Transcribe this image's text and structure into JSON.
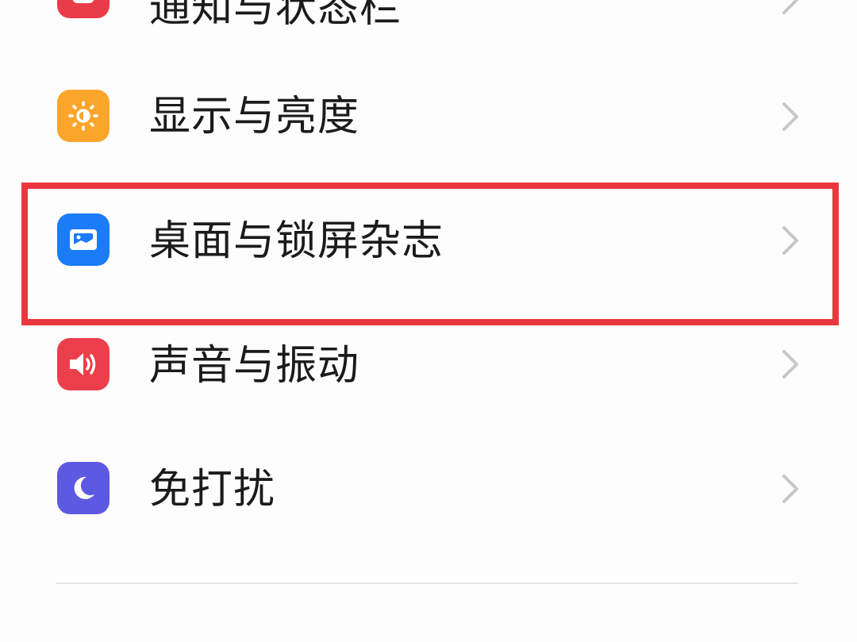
{
  "settings_list": {
    "items": [
      {
        "label": "通知与状态栏",
        "icon": "notification-icon",
        "icon_color": "#ea3b48"
      },
      {
        "label": "显示与亮度",
        "icon": "sun-icon",
        "icon_color": "#fba62a"
      },
      {
        "label": "桌面与锁屏杂志",
        "icon": "wallpaper-icon",
        "icon_color": "#1a7cf6"
      },
      {
        "label": "声音与振动",
        "icon": "speaker-icon",
        "icon_color": "#ec3e4b"
      },
      {
        "label": "免打扰",
        "icon": "moon-icon",
        "icon_color": "#5d59e0"
      }
    ],
    "highlighted_index": 2,
    "highlight_color": "#e8383d"
  }
}
